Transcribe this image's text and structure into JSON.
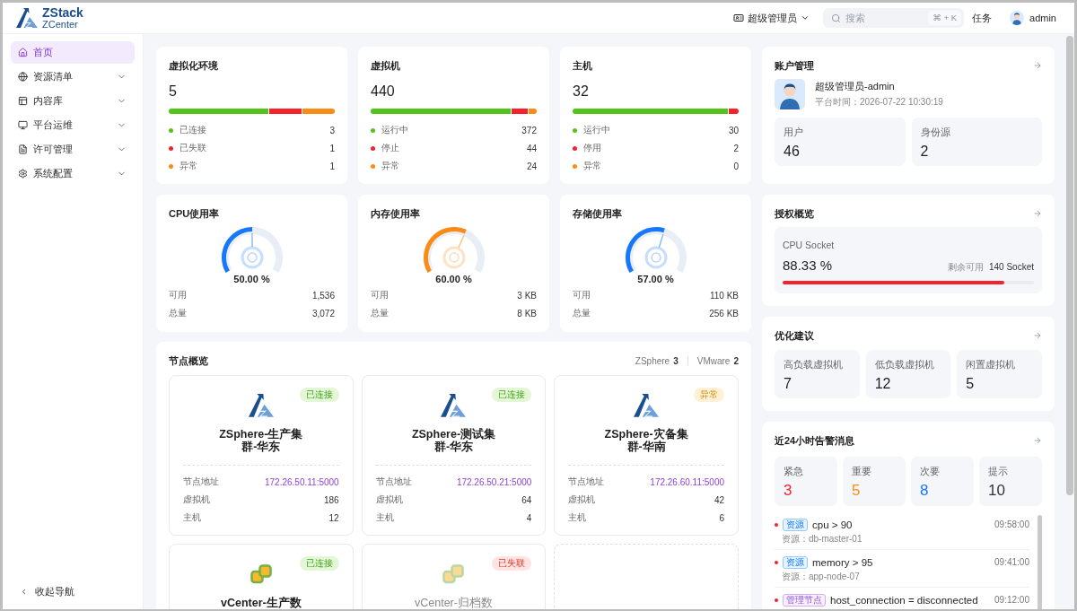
{
  "header": {
    "brand": "ZStack",
    "product": "ZCenter",
    "role": "超级管理员",
    "search": {
      "placeholder": "搜索",
      "shortcut": "⌘ + K"
    },
    "tasks": "任务",
    "user": "admin"
  },
  "sidebar": {
    "items": [
      {
        "label": "首页",
        "selected": true,
        "expandable": false
      },
      {
        "label": "资源清单",
        "selected": false,
        "expandable": true
      },
      {
        "label": "内容库",
        "selected": false,
        "expandable": true
      },
      {
        "label": "平台运维",
        "selected": false,
        "expandable": true
      },
      {
        "label": "许可管理",
        "selected": false,
        "expandable": true
      },
      {
        "label": "系统配置",
        "selected": false,
        "expandable": true
      }
    ],
    "collapse": "收起导航"
  },
  "summary_cards": [
    {
      "title": "虚拟化环境",
      "total": "5",
      "items": [
        {
          "label": "已连接",
          "value": "3",
          "color": "#52c41a"
        },
        {
          "label": "已失联",
          "value": "1",
          "color": "#f5222d"
        },
        {
          "label": "异常",
          "value": "1",
          "color": "#fa8c16"
        }
      ]
    },
    {
      "title": "虚拟机",
      "total": "440",
      "items": [
        {
          "label": "运行中",
          "value": "372",
          "color": "#52c41a"
        },
        {
          "label": "停止",
          "value": "44",
          "color": "#f5222d"
        },
        {
          "label": "异常",
          "value": "24",
          "color": "#fa8c16"
        }
      ]
    },
    {
      "title": "主机",
      "total": "32",
      "items": [
        {
          "label": "运行中",
          "value": "30",
          "color": "#52c41a"
        },
        {
          "label": "停用",
          "value": "2",
          "color": "#f5222d"
        },
        {
          "label": "异常",
          "value": "0",
          "color": "#fa8c16"
        }
      ]
    }
  ],
  "gauges": [
    {
      "title": "CPU使用率",
      "color": "#1677ff",
      "reading": "50.00 %",
      "rows": [
        {
          "label": "可用",
          "value": "1,536"
        },
        {
          "label": "总量",
          "value": "3,072"
        }
      ]
    },
    {
      "title": "内存使用率",
      "color": "#fa8c16",
      "reading": "60.00 %",
      "rows": [
        {
          "label": "可用",
          "value": "3 KB"
        },
        {
          "label": "总量",
          "value": "8 KB"
        }
      ]
    },
    {
      "title": "存储使用率",
      "color": "#1677ff",
      "reading": "57.00 %",
      "rows": [
        {
          "label": "可用",
          "value": "110 KB"
        },
        {
          "label": "总量",
          "value": "256 KB"
        }
      ]
    }
  ],
  "nodes": {
    "title": "节点概览",
    "counts": [
      {
        "label": "ZSphere",
        "value": "3"
      },
      {
        "label": "VMware",
        "value": "2"
      }
    ],
    "cards": [
      {
        "kind": "zsphere",
        "name": "ZSphere-生产集群-华东",
        "status": {
          "text": "已连接",
          "kind": "connected"
        },
        "rows": [
          {
            "label": "节点地址",
            "value": "172.26.50.11:5000",
            "kind": "address"
          },
          {
            "label": "虚拟机",
            "value": "186",
            "kind": "plain"
          },
          {
            "label": "主机",
            "value": "12",
            "kind": "plain"
          }
        ]
      },
      {
        "kind": "zsphere",
        "name": "ZSphere-测试集群-华东",
        "status": {
          "text": "已连接",
          "kind": "connected"
        },
        "rows": [
          {
            "label": "节点地址",
            "value": "172.26.50.21:5000",
            "kind": "address"
          },
          {
            "label": "虚拟机",
            "value": "64",
            "kind": "plain"
          },
          {
            "label": "主机",
            "value": "4",
            "kind": "plain"
          }
        ]
      },
      {
        "kind": "zsphere",
        "name": "ZSphere-灾备集群-华南",
        "status": {
          "text": "异常",
          "kind": "abnormal"
        },
        "rows": [
          {
            "label": "节点地址",
            "value": "172.26.60.11:5000",
            "kind": "address"
          },
          {
            "label": "虚拟机",
            "value": "42",
            "kind": "plain"
          },
          {
            "label": "主机",
            "value": "6",
            "kind": "plain"
          }
        ]
      },
      {
        "kind": "vcenter",
        "name": "vCenter-生产数",
        "status": {
          "text": "已连接",
          "kind": "connected"
        }
      },
      {
        "kind": "vcenter",
        "name": "vCenter-归档数",
        "status": {
          "text": "已失联",
          "kind": "lost"
        }
      },
      {
        "kind": "empty"
      }
    ]
  },
  "account": {
    "title": "账户管理",
    "name": "超级管理员-admin",
    "time": "平台时间：2026-07-22 10:30:19",
    "stats": [
      {
        "label": "用户",
        "value": "46"
      },
      {
        "label": "身份源",
        "value": "2"
      }
    ]
  },
  "license": {
    "title": "授权概览",
    "name": "CPU Socket",
    "percent": "88.33 %",
    "remaining_label": "剩余可用",
    "remaining": "140 Socket",
    "level": 0.8833
  },
  "optimization": {
    "title": "优化建议",
    "stats": [
      {
        "label": "高负载虚拟机",
        "value": "7"
      },
      {
        "label": "低负载虚拟机",
        "value": "12"
      },
      {
        "label": "闲置虚拟机",
        "value": "5"
      }
    ]
  },
  "alerts": {
    "title": "近24小时告警消息",
    "levels": [
      {
        "label": "紧急",
        "value": "3",
        "color": "#f5222d"
      },
      {
        "label": "重要",
        "value": "5",
        "color": "#fa8c16"
      },
      {
        "label": "次要",
        "value": "8",
        "color": "#1677ff"
      },
      {
        "label": "提示",
        "value": "10",
        "color": "#333333"
      }
    ],
    "items": [
      {
        "color": "#f5222d",
        "tag": {
          "text": "资源",
          "kind": "resource"
        },
        "text": "cpu > 90",
        "time": "09:58:00",
        "detail": "资源：db-master-01"
      },
      {
        "color": "#f5222d",
        "tag": {
          "text": "资源",
          "kind": "resource"
        },
        "text": "memory > 95",
        "time": "09:41:00",
        "detail": "资源：app-node-07"
      },
      {
        "color": "#f5222d",
        "tag": {
          "text": "管理节点",
          "kind": "management"
        },
        "text": "host_connection = disconnected",
        "time": "09:12:00"
      }
    ]
  }
}
